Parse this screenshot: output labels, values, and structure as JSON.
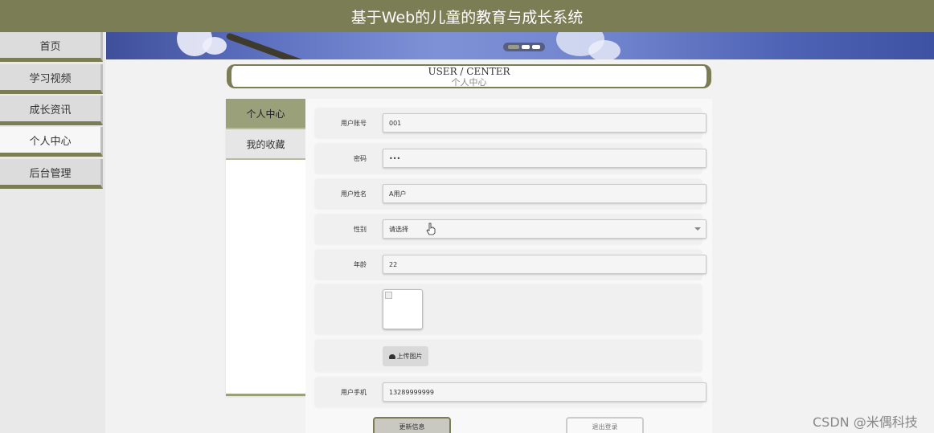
{
  "app": {
    "title": "基于Web的儿童的教育与成长系统"
  },
  "sidebar": {
    "items": [
      {
        "label": "首页",
        "active": false
      },
      {
        "label": "学习视频",
        "active": false
      },
      {
        "label": "成长资讯",
        "active": false
      },
      {
        "label": "个人中心",
        "active": true
      },
      {
        "label": "后台管理",
        "active": false
      }
    ]
  },
  "banner": {
    "slides": 3,
    "current_slide": 1
  },
  "section": {
    "title_en": "USER / CENTER",
    "title_cn": "个人中心"
  },
  "tabs": [
    {
      "label": "个人中心",
      "active": true
    },
    {
      "label": "我的收藏",
      "active": false
    }
  ],
  "form": {
    "account": {
      "label": "用户账号",
      "value": "001"
    },
    "password": {
      "label": "密码",
      "value": "•••"
    },
    "name": {
      "label": "用户姓名",
      "value": "A用户"
    },
    "gender": {
      "label": "性别",
      "value": "请选择"
    },
    "age": {
      "label": "年龄",
      "value": "22"
    },
    "upload_label": "上传图片",
    "phone": {
      "label": "用户手机",
      "value": "13289999999"
    }
  },
  "actions": {
    "update": "更新信息",
    "logout": "退出登录"
  },
  "watermark": "CSDN @米偶科技",
  "colors": {
    "accent": "#7b7d55",
    "tab_active": "#9aa07a"
  }
}
